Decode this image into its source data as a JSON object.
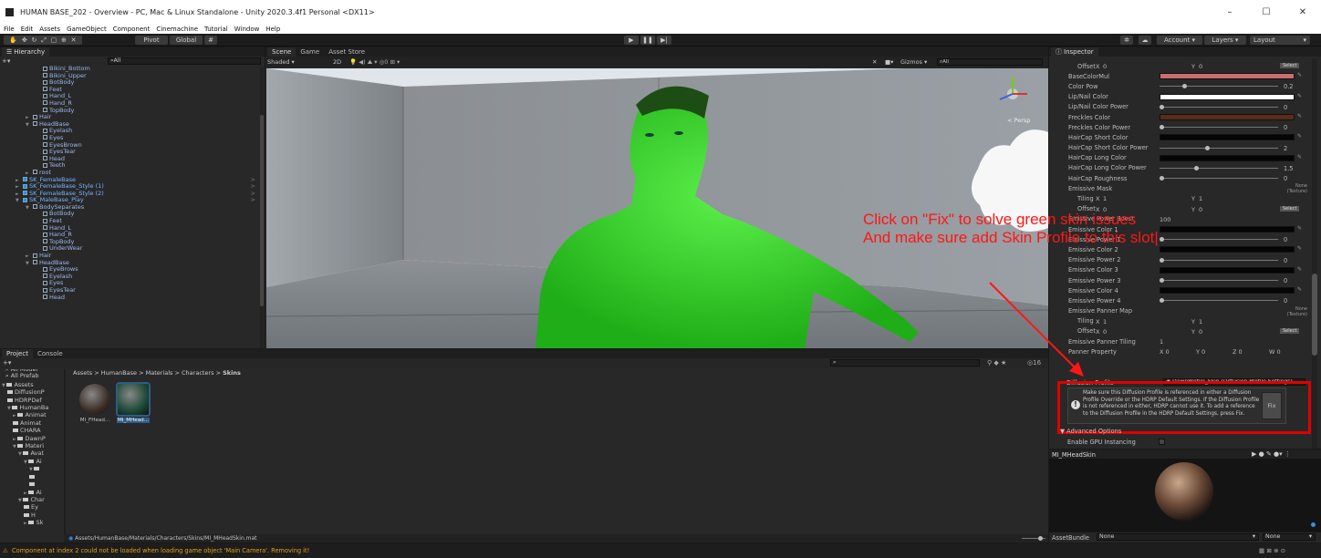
{
  "window": {
    "title": "HUMAN BASE_202 - Overview - PC, Mac & Linux Standalone - Unity 2020.3.4f1 Personal <DX11>",
    "min": "–",
    "max": "☐",
    "close": "✕"
  },
  "menu": [
    "File",
    "Edit",
    "Assets",
    "GameObject",
    "Component",
    "Cinemachine",
    "Tutorial",
    "Window",
    "Help"
  ],
  "toolbar": {
    "pivot": "Pivot",
    "global": "Global",
    "account": "Account",
    "layers": "Layers",
    "layout": "Layout",
    "play": "▶",
    "pause": "❚❚",
    "step": "▶|"
  },
  "hierarchy": {
    "tab": "Hierarchy",
    "search": "All",
    "rows": [
      {
        "d": 3,
        "t": "Bikini_Bottom"
      },
      {
        "d": 3,
        "t": "Bikini_Upper"
      },
      {
        "d": 3,
        "t": "BotBody"
      },
      {
        "d": 3,
        "t": "Feet"
      },
      {
        "d": 3,
        "t": "Hand_L"
      },
      {
        "d": 3,
        "t": "Hand_R"
      },
      {
        "d": 3,
        "t": "TopBody"
      },
      {
        "d": 2,
        "t": "Hair",
        "a": "►"
      },
      {
        "d": 2,
        "t": "HeadBase",
        "a": "▼"
      },
      {
        "d": 3,
        "t": "Eyelash"
      },
      {
        "d": 3,
        "t": "Eyes"
      },
      {
        "d": 3,
        "t": "EyesBrown"
      },
      {
        "d": 3,
        "t": "EyesTear"
      },
      {
        "d": 3,
        "t": "Head"
      },
      {
        "d": 3,
        "t": "Teeth"
      },
      {
        "d": 2,
        "t": "root",
        "a": "►"
      },
      {
        "d": 1,
        "t": "SK_FemaleBase",
        "a": "►",
        "p": 1
      },
      {
        "d": 1,
        "t": "SK_FemaleBase_Style (1)",
        "a": "►",
        "p": 1
      },
      {
        "d": 1,
        "t": "SK_FemaleBase_Style (2)",
        "a": "►",
        "p": 1
      },
      {
        "d": 1,
        "t": "SK_MaleBase_Play",
        "a": "▼",
        "p": 1
      },
      {
        "d": 2,
        "t": "BodySeparates",
        "a": "▼"
      },
      {
        "d": 3,
        "t": "BotBody"
      },
      {
        "d": 3,
        "t": "Feet"
      },
      {
        "d": 3,
        "t": "Hand_L"
      },
      {
        "d": 3,
        "t": "Hand_R"
      },
      {
        "d": 3,
        "t": "TopBody"
      },
      {
        "d": 3,
        "t": "UnderWear"
      },
      {
        "d": 2,
        "t": "Hair",
        "a": "►"
      },
      {
        "d": 2,
        "t": "HeadBase",
        "a": "▼"
      },
      {
        "d": 3,
        "t": "EyeBrows"
      },
      {
        "d": 3,
        "t": "Eyelash"
      },
      {
        "d": 3,
        "t": "Eyes"
      },
      {
        "d": 3,
        "t": "EyesTear"
      },
      {
        "d": 3,
        "t": "Head"
      }
    ]
  },
  "scene": {
    "tabs": [
      "Scene",
      "Game",
      "Asset Store"
    ],
    "shaded": "Shaded",
    "mode2d": "2D",
    "gizmos": "Gizmos",
    "search": "All",
    "persp": "< Persp"
  },
  "inspector": {
    "tab": "Inspector",
    "rows": [
      {
        "l": "Offset",
        "k": "xy",
        "x": "0",
        "y": "0",
        "btn": "Select"
      },
      {
        "l": "BaseColorMul",
        "k": "color",
        "c": "#c96e6e"
      },
      {
        "l": "Color Pow",
        "k": "slider",
        "v": "0.2",
        "f": 0.2
      },
      {
        "l": "Lip/Nail Color",
        "k": "color",
        "c": "#ffffff"
      },
      {
        "l": "Lip/Nail Color Power",
        "k": "slider",
        "v": "0",
        "f": 0
      },
      {
        "l": "Freckles Color",
        "k": "color",
        "c": "#5a2d18"
      },
      {
        "l": "Freckles Color Power",
        "k": "slider",
        "v": "0",
        "f": 0
      },
      {
        "l": "HairCap Short Color",
        "k": "color",
        "c": "#050505"
      },
      {
        "l": "HairCap Short Color Power",
        "k": "slider",
        "v": "2",
        "f": 0.4
      },
      {
        "l": "HairCap Long Color",
        "k": "color",
        "c": "#050505"
      },
      {
        "l": "HairCap Long Color Power",
        "k": "slider",
        "v": "1.5",
        "f": 0.3
      },
      {
        "l": "HairCap Roughness",
        "k": "slider",
        "v": "0",
        "f": 0
      },
      {
        "l": "Emissive Mask",
        "k": "tex",
        "t": "None (Texture)"
      },
      {
        "l": "Tiling",
        "k": "xy2",
        "x": "1",
        "y": "1"
      },
      {
        "l": "Offset",
        "k": "xy2",
        "x": "0",
        "y": "0",
        "btn": "Select"
      },
      {
        "l": "Emissive Power Boost",
        "k": "val",
        "v": "100"
      },
      {
        "l": "Emissive Color 1",
        "k": "color",
        "c": "#050505"
      },
      {
        "l": "Emissive Power 1",
        "k": "slider",
        "v": "0",
        "f": 0
      },
      {
        "l": "Emissive Color 2",
        "k": "color",
        "c": "#050505"
      },
      {
        "l": "Emissive Power 2",
        "k": "slider",
        "v": "0",
        "f": 0
      },
      {
        "l": "Emissive Color 3",
        "k": "color",
        "c": "#050505"
      },
      {
        "l": "Emissive Power 3",
        "k": "slider",
        "v": "0",
        "f": 0
      },
      {
        "l": "Emissive Color 4",
        "k": "color",
        "c": "#050505"
      },
      {
        "l": "Emissive Power 4",
        "k": "slider",
        "v": "0",
        "f": 0
      },
      {
        "l": "Emissive Panner Map",
        "k": "tex",
        "t": "None (Texture)"
      },
      {
        "l": "Tiling",
        "k": "xy2",
        "x": "1",
        "y": "1"
      },
      {
        "l": "Offset",
        "k": "xy2",
        "x": "0",
        "y": "0",
        "btn": "Select"
      },
      {
        "l": "Emissive Panner Tiling",
        "k": "val",
        "v": "1"
      },
      {
        "l": "Panner Property",
        "k": "xyzw",
        "x": "0",
        "y": "0",
        "z": "0",
        "w": "0"
      }
    ],
    "diffusion": {
      "label": "Diffusion Profile",
      "value": "DawnProfile_Skin (Diffusion Profile Settings)",
      "help": "Make sure this Diffusion Profile is referenced in either a Diffusion Profile Override or the HDRP Default Settings. If the Diffusion Profile is not referenced in either, HDRP cannot use it. To add a reference to the Diffusion Profile in the HDRP Default Settings, press Fix.",
      "fix": "Fix"
    },
    "advanced": "Advanced Options",
    "gpu": "Enable GPU Instancing",
    "preview_title": "MI_MHeadSkin",
    "assetbundle": "AssetBundle",
    "none1": "None",
    "none2": "None"
  },
  "annotation": {
    "line1": "Click on \"Fix\" to solve green skin issues",
    "line2": "And make sure add Skin Profile to this slot|"
  },
  "project": {
    "tabs": [
      "Project",
      "Console"
    ],
    "breadcrumb": [
      "Assets",
      "HumanBase",
      "Materials",
      "Characters",
      "Skins"
    ],
    "favorites": [
      "All Model",
      "All Prefab"
    ],
    "tree": [
      {
        "d": 0,
        "t": "Assets",
        "a": "▼"
      },
      {
        "d": 1,
        "t": "DiffusionP"
      },
      {
        "d": 1,
        "t": "HDRPDef"
      },
      {
        "d": 1,
        "t": "HumanBa",
        "a": "▼"
      },
      {
        "d": 2,
        "t": "Animat",
        "a": "►"
      },
      {
        "d": 2,
        "t": "Animat"
      },
      {
        "d": 2,
        "t": "CHARA"
      },
      {
        "d": 2,
        "t": "DawnP",
        "a": "►"
      },
      {
        "d": 2,
        "t": "Materi",
        "a": "▼"
      },
      {
        "d": 3,
        "t": "Avat",
        "a": "▼"
      },
      {
        "d": 4,
        "t": "Ai",
        "a": "▼"
      },
      {
        "d": 5,
        "t": "",
        "a": "▼"
      },
      {
        "d": 5,
        "t": ""
      },
      {
        "d": 5,
        "t": ""
      },
      {
        "d": 4,
        "t": "Ai",
        "a": "►"
      },
      {
        "d": 3,
        "t": "Char",
        "a": "▼"
      },
      {
        "d": 4,
        "t": "Ey"
      },
      {
        "d": 4,
        "t": "H"
      },
      {
        "d": 4,
        "t": "Sk",
        "a": "►"
      }
    ],
    "assets": [
      {
        "name": "MI_FHead..."
      },
      {
        "name": "MI_MHead..."
      }
    ],
    "path": "Assets/HumanBase/Materials/Characters/Skins/MI_MHeadSkin.mat",
    "badge": "16"
  },
  "status": {
    "text": "Component at index 2 could not be loaded when loading game object 'Main Camera'. Removing it!"
  },
  "colors": {
    "accent": "#2c5d87",
    "warning": "#e0a21a",
    "annotation": "#ff1616",
    "highlight_box": "#e00000"
  }
}
